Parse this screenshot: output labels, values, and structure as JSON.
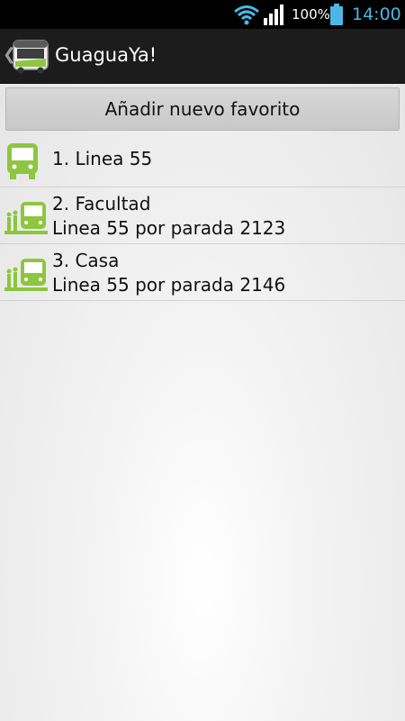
{
  "status_bar": {
    "battery_percent": "100%",
    "time": "14:00",
    "icons": [
      "wifi-icon",
      "signal-icon",
      "battery-icon"
    ]
  },
  "action_bar": {
    "title": "GuaguaYa!",
    "icons": [
      "back-chevron-icon",
      "bus-app-icon"
    ]
  },
  "add_button": {
    "label": "Añadir nuevo favorito"
  },
  "favorites": [
    {
      "title": "1. Linea 55",
      "subtitle": "",
      "icon": "bus-icon"
    },
    {
      "title": "2. Facultad",
      "subtitle": "Linea 55 por parada 2123",
      "icon": "bus-stop-icon"
    },
    {
      "title": "3. Casa",
      "subtitle": "Linea 55 por parada 2146",
      "icon": "bus-stop-icon"
    }
  ],
  "colors": {
    "accent_green": "#8dc63f",
    "status_blue": "#4cb7e6"
  }
}
